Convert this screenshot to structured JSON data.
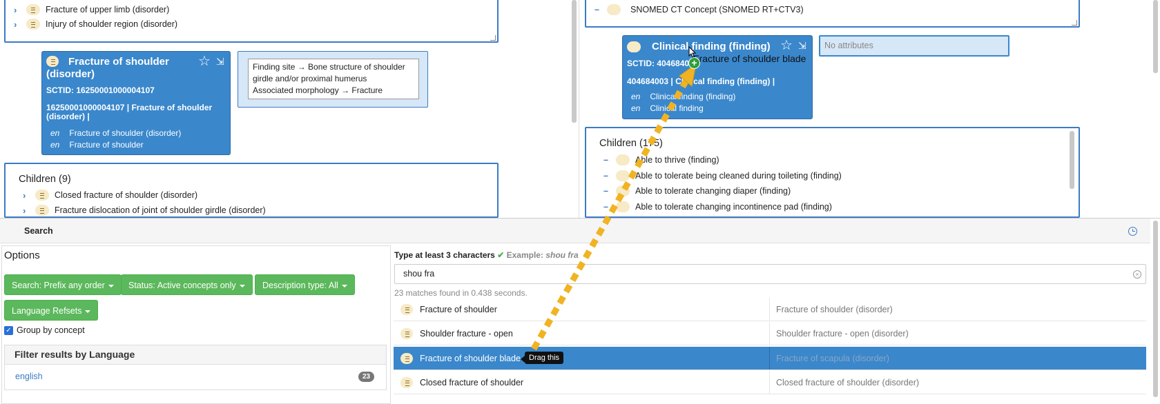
{
  "left_top_list": {
    "items": [
      {
        "label": "Fracture of upper limb (disorder)"
      },
      {
        "label": "Injury of shoulder region (disorder)"
      }
    ]
  },
  "left_concept": {
    "title": "Fracture of shoulder (disorder)",
    "sctid": "SCTID: 16250001000004107",
    "fsn_line": "16250001000004107 | Fracture of shoulder (disorder) |",
    "descriptions": [
      {
        "lang": "en",
        "text": "Fracture of shoulder (disorder)"
      },
      {
        "lang": "en",
        "text": "Fracture of shoulder"
      }
    ],
    "attributes": [
      "Finding site → Bone structure of shoulder girdle and/or proximal humerus",
      "Associated morphology → Fracture"
    ]
  },
  "left_children": {
    "heading": "Children (9)",
    "items": [
      {
        "label": "Closed fracture of shoulder (disorder)"
      },
      {
        "label": "Fracture dislocation of joint of shoulder girdle (disorder)"
      }
    ]
  },
  "right_parent": {
    "label": "SNOMED CT Concept (SNOMED RT+CTV3)"
  },
  "right_concept": {
    "title": "Clinical finding (finding)",
    "sctid": "SCTID: 404684003",
    "fsn_line": "404684003 | Clinical finding (finding) |",
    "descriptions": [
      {
        "lang": "en",
        "text": "Clinical finding (finding)"
      },
      {
        "lang": "en",
        "text": "Clinical finding"
      }
    ],
    "no_attributes": "No attributes"
  },
  "right_children": {
    "heading": "Children (175)",
    "items": [
      {
        "label": "Able to thrive (finding)"
      },
      {
        "label": "Able to tolerate being cleaned during toileting (finding)"
      },
      {
        "label": "Able to tolerate changing diaper (finding)"
      },
      {
        "label": "Able to tolerate changing incontinence pad (finding)"
      }
    ]
  },
  "drag": {
    "ghost_text": "Fracture of shoulder blade",
    "tooltip": "Drag this",
    "colors": {
      "arrow": "#f0b323",
      "plus": "#2e9e3a"
    }
  },
  "search": {
    "header": "Search",
    "options_title": "Options",
    "buttons": {
      "search_mode": "Search: Prefix any order",
      "status": "Status: Active concepts only",
      "desc_type": "Description type: All",
      "lang_refsets": "Language Refsets"
    },
    "group_by_concept": "Group by concept",
    "filter_title": "Filter results by Language",
    "language": {
      "label": "english",
      "count": "23"
    },
    "hint_prefix": "Type at least 3 characters",
    "hint_example_label": "Example:",
    "hint_example": "shou fra",
    "query": "shou fra",
    "match_info": "23 matches found in 0.438 seconds.",
    "results": [
      {
        "term": "Fracture of shoulder",
        "fsn": "Fracture of shoulder (disorder)"
      },
      {
        "term": "Shoulder fracture - open",
        "fsn": "Shoulder fracture - open (disorder)"
      },
      {
        "term": "Fracture of shoulder blade",
        "fsn": "Fracture of scapula (disorder)"
      },
      {
        "term": "Closed fracture of shoulder",
        "fsn": "Closed fracture of shoulder (disorder)"
      }
    ],
    "colors": {
      "accent": "#3a87cc",
      "green": "#5cb85c"
    }
  }
}
